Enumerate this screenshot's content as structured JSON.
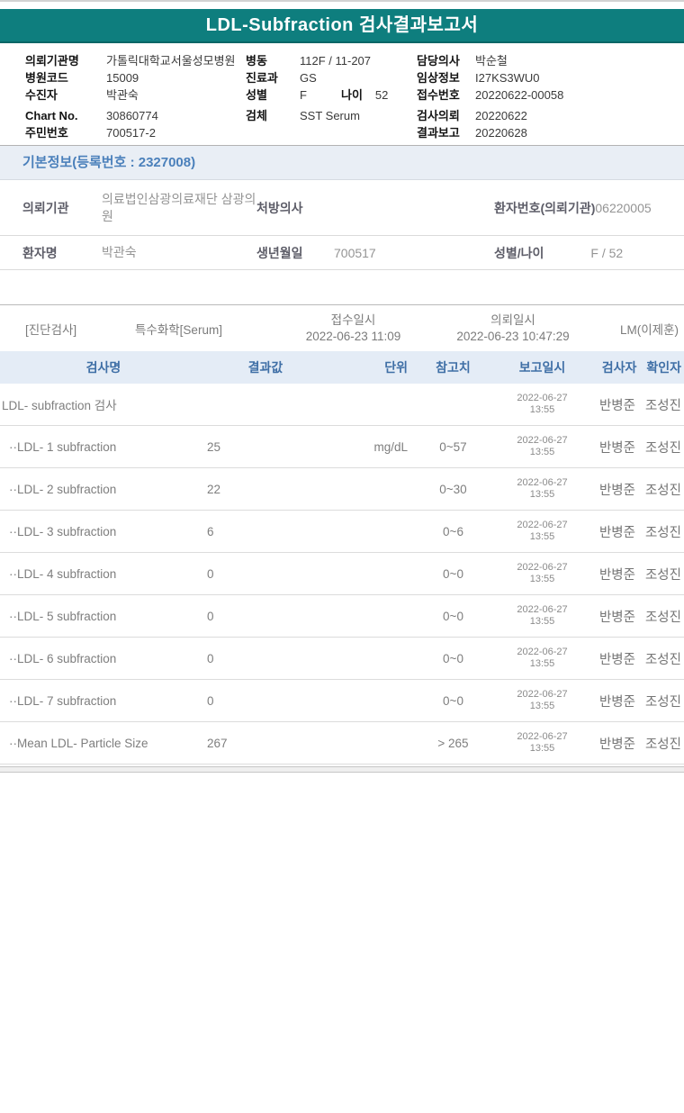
{
  "report": {
    "title": "LDL-Subfraction 검사결과보고서"
  },
  "patient_header": {
    "col1": [
      {
        "label": "의뢰기관명",
        "value": "가톨릭대학교서울성모병원"
      },
      {
        "label": "병원코드",
        "value": "15009"
      },
      {
        "label": "수진자",
        "value": "박관숙"
      },
      {
        "label": "Chart No.",
        "value": "30860774"
      },
      {
        "label": "주민번호",
        "value": "700517-2"
      }
    ],
    "col2": [
      {
        "label": "병동",
        "value": "112F / 11-207"
      },
      {
        "label": "진료과",
        "value": "GS"
      },
      {
        "label": "성별",
        "value": "F",
        "label2": "나이",
        "value2": "52"
      },
      {
        "label": "검체",
        "value": "SST Serum"
      }
    ],
    "col3": [
      {
        "label": "담당의사",
        "value": "박순철"
      },
      {
        "label": "임상정보",
        "value": "I27KS3WU0"
      },
      {
        "label": "접수번호",
        "value": "20220622-00058"
      },
      {
        "label": "검사의뢰",
        "value": "20220622"
      },
      {
        "label": "결과보고",
        "value": "20220628"
      }
    ]
  },
  "basic_info": {
    "section_title": "기본정보(등록번호 : 2327008)",
    "row1": {
      "label1": "의뢰기관",
      "value1": "의료법인삼광의료재단 삼광의원",
      "label2": "처방의사",
      "value2": "",
      "label3": "환자번호(의뢰기관)",
      "value3": "06220005"
    },
    "row2": {
      "label1": "환자명",
      "value1": "박관숙",
      "label2": "생년월일",
      "value2": "700517",
      "label3": "성별/나이",
      "value3": "F / 52"
    }
  },
  "exam_section": {
    "category": "[진단검사]",
    "test_type": "특수화학[Serum]",
    "receipt_label": "접수일시",
    "receipt_datetime": "2022-06-23 11:09",
    "request_label": "의뢰일시",
    "request_datetime": "2022-06-23 10:47:29",
    "performing_lab": "LM(이제훈)"
  },
  "results_table": {
    "headers": {
      "name": "검사명",
      "result": "결과값",
      "unit": "단위",
      "reference": "참고치",
      "report_datetime": "보고일시",
      "examiner": "검사자",
      "confirmer": "확인자"
    },
    "rows": [
      {
        "name": "LDL- subfraction 검사",
        "result": "",
        "unit": "",
        "reference": "",
        "report_date": "2022-06-27",
        "report_time": "13:55",
        "examiner": "반병준",
        "confirmer": "조성진"
      },
      {
        "name": "··LDL- 1 subfraction",
        "result": "25",
        "unit": "mg/dL",
        "reference": "0~57",
        "report_date": "2022-06-27",
        "report_time": "13:55",
        "examiner": "반병준",
        "confirmer": "조성진"
      },
      {
        "name": "··LDL- 2 subfraction",
        "result": "22",
        "unit": "",
        "reference": "0~30",
        "report_date": "2022-06-27",
        "report_time": "13:55",
        "examiner": "반병준",
        "confirmer": "조성진"
      },
      {
        "name": "··LDL- 3 subfraction",
        "result": "6",
        "unit": "",
        "reference": "0~6",
        "report_date": "2022-06-27",
        "report_time": "13:55",
        "examiner": "반병준",
        "confirmer": "조성진"
      },
      {
        "name": "··LDL- 4 subfraction",
        "result": "0",
        "unit": "",
        "reference": "0~0",
        "report_date": "2022-06-27",
        "report_time": "13:55",
        "examiner": "반병준",
        "confirmer": "조성진"
      },
      {
        "name": "··LDL- 5 subfraction",
        "result": "0",
        "unit": "",
        "reference": "0~0",
        "report_date": "2022-06-27",
        "report_time": "13:55",
        "examiner": "반병준",
        "confirmer": "조성진"
      },
      {
        "name": "··LDL- 6 subfraction",
        "result": "0",
        "unit": "",
        "reference": "0~0",
        "report_date": "2022-06-27",
        "report_time": "13:55",
        "examiner": "반병준",
        "confirmer": "조성진"
      },
      {
        "name": "··LDL- 7 subfraction",
        "result": "0",
        "unit": "",
        "reference": "0~0",
        "report_date": "2022-06-27",
        "report_time": "13:55",
        "examiner": "반병준",
        "confirmer": "조성진"
      },
      {
        "name": "··Mean LDL- Particle Size",
        "result": "267",
        "unit": "",
        "reference": "> 265",
        "report_date": "2022-06-27",
        "report_time": "13:55",
        "examiner": "반병준",
        "confirmer": "조성진"
      }
    ]
  },
  "colors": {
    "header_teal": "#0e7e7e",
    "accent_blue": "#4b80bb",
    "table_header_bg": "#e4ecf6"
  }
}
